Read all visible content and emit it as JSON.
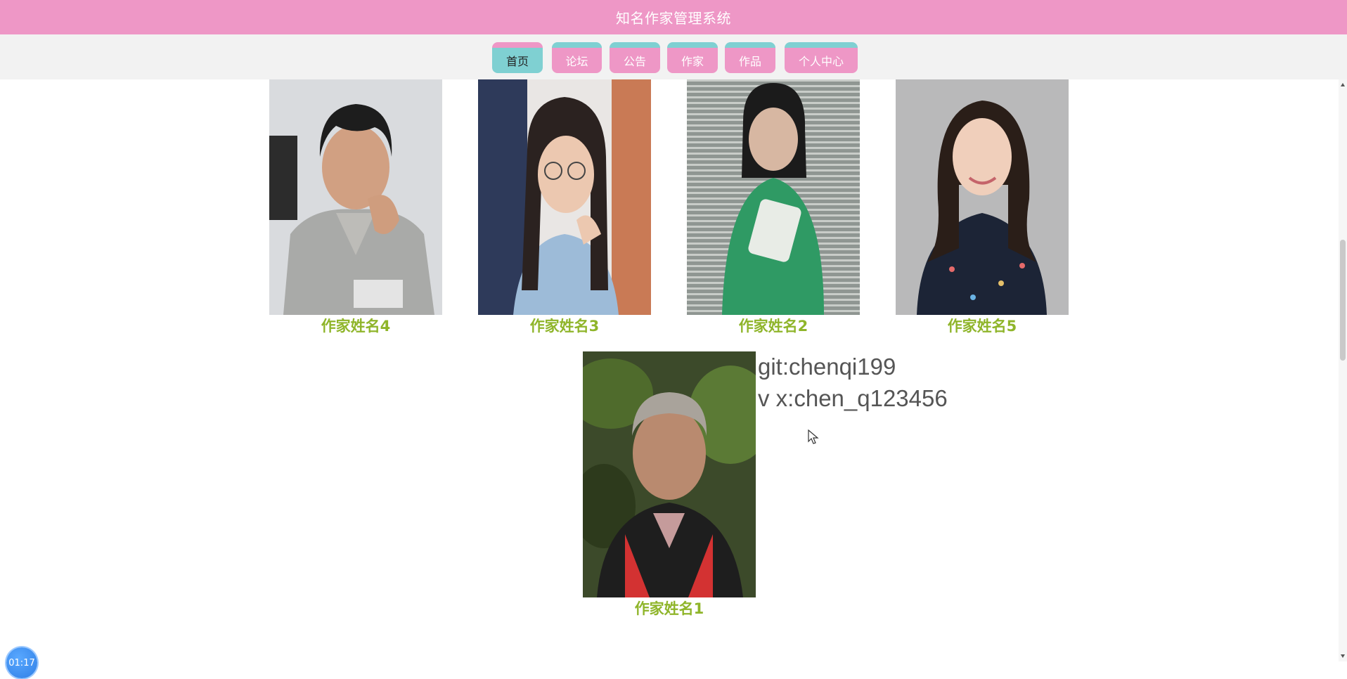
{
  "header": {
    "title": "知名作家管理系统"
  },
  "nav": {
    "items": [
      {
        "label": "首页",
        "active": true
      },
      {
        "label": "论坛",
        "active": false
      },
      {
        "label": "公告",
        "active": false
      },
      {
        "label": "作家",
        "active": false
      },
      {
        "label": "作品",
        "active": false
      },
      {
        "label": "个人中心",
        "active": false
      }
    ]
  },
  "writers": [
    {
      "name": "作家姓名4"
    },
    {
      "name": "作家姓名3"
    },
    {
      "name": "作家姓名2"
    },
    {
      "name": "作家姓名5"
    },
    {
      "name": "作家姓名1"
    }
  ],
  "contact": {
    "git": "git:chenqi199",
    "wechat": "v x:chen_q123456"
  },
  "overlay": {
    "timer": "01:17"
  },
  "colors": {
    "header_bg": "#ee97c6",
    "nav_accent": "#7fd0d2",
    "name_color": "#8fb52a"
  }
}
